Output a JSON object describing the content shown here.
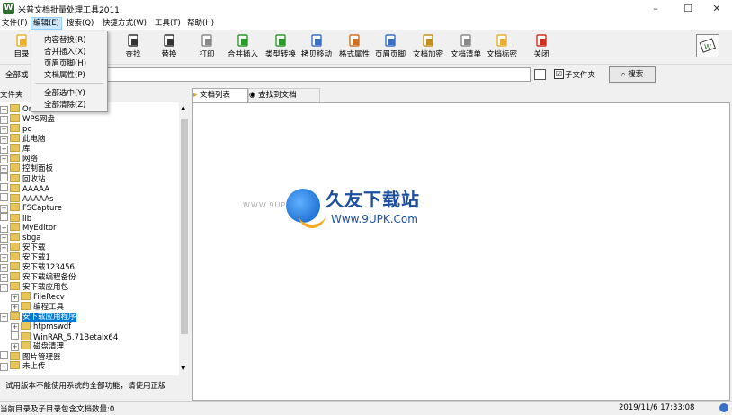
{
  "window": {
    "title": "米普文档批量处理工具2011",
    "minimize": "–",
    "maximize": "☐",
    "close": "✕"
  },
  "menubar": [
    {
      "label": "文件(F)"
    },
    {
      "label": "编辑(E)"
    },
    {
      "label": "搜索(Q)"
    },
    {
      "label": "快捷方式(W)"
    },
    {
      "label": "工具(T)"
    },
    {
      "label": "帮助(H)"
    }
  ],
  "edit_menu": {
    "items": [
      "内容替换(R)",
      "合并插入(X)",
      "页眉页脚(H)",
      "文档属性(P)",
      "全部选中(Y)",
      "全部清除(Z)"
    ]
  },
  "toolbar": [
    {
      "label": "目录",
      "icon": "folder-icon",
      "color": "#e8b030"
    },
    {
      "label": "查找",
      "icon": "binoculars-icon",
      "color": "#333333"
    },
    {
      "label": "替换",
      "icon": "replace-icon",
      "color": "#333333"
    },
    {
      "label": "打印",
      "icon": "printer-icon",
      "color": "#888888"
    },
    {
      "label": "合并插入",
      "icon": "merge-icon",
      "color": "#2a9a2a"
    },
    {
      "label": "类型转换",
      "icon": "convert-icon",
      "color": "#2a9a2a"
    },
    {
      "label": "拷贝移动",
      "icon": "copy-icon",
      "color": "#3a6fc4"
    },
    {
      "label": "格式属性",
      "icon": "format-icon",
      "color": "#d07020"
    },
    {
      "label": "页眉页脚",
      "icon": "header-icon",
      "color": "#3a6fc4"
    },
    {
      "label": "文档加密",
      "icon": "lock-icon",
      "color": "#c09020"
    },
    {
      "label": "文档清单",
      "icon": "list-icon",
      "color": "#888888"
    },
    {
      "label": "文档标密",
      "icon": "star-icon",
      "color": "#e8b030"
    },
    {
      "label": "关闭",
      "icon": "power-icon",
      "color": "#d03020"
    }
  ],
  "search": {
    "label": "全部或",
    "subdir_label": "子文件夹",
    "subdir_checked": "☑",
    "button": "搜索"
  },
  "folder_panel": {
    "header": "文件夹"
  },
  "tree": [
    {
      "label": "OneDrive",
      "indent": 0,
      "exp": true
    },
    {
      "label": "WPS网盘",
      "indent": 0,
      "exp": true
    },
    {
      "label": "pc",
      "indent": 0,
      "exp": true
    },
    {
      "label": "此电脑",
      "indent": 0,
      "exp": true
    },
    {
      "label": "库",
      "indent": 0,
      "exp": true
    },
    {
      "label": "网络",
      "indent": 0,
      "exp": true
    },
    {
      "label": "控制面板",
      "indent": 0,
      "exp": true
    },
    {
      "label": "回收站",
      "indent": 0,
      "exp": false
    },
    {
      "label": "AAAAA",
      "indent": 0,
      "exp": false
    },
    {
      "label": "AAAAAs",
      "indent": 0,
      "exp": false
    },
    {
      "label": "FSCapture",
      "indent": 0,
      "exp": true
    },
    {
      "label": "lib",
      "indent": 0,
      "exp": false
    },
    {
      "label": "MyEditor",
      "indent": 0,
      "exp": true
    },
    {
      "label": "sbga",
      "indent": 0,
      "exp": true
    },
    {
      "label": "安下载",
      "indent": 0,
      "exp": true
    },
    {
      "label": "安下载1",
      "indent": 0,
      "exp": true
    },
    {
      "label": "安下载123456",
      "indent": 0,
      "exp": true
    },
    {
      "label": "安下载编程备份",
      "indent": 0,
      "exp": true
    },
    {
      "label": "安下载应用包",
      "indent": 0,
      "exp": true
    },
    {
      "label": "FileRecv",
      "indent": 1,
      "exp": true
    },
    {
      "label": "编程工具",
      "indent": 1,
      "exp": true
    },
    {
      "label": "安下载应用程序",
      "indent": 0,
      "exp": true,
      "selected": true
    },
    {
      "label": "htpmswdf",
      "indent": 1,
      "exp": true
    },
    {
      "label": "WinRAR_5.71Betalx64",
      "indent": 1,
      "exp": false
    },
    {
      "label": "磁盘清理",
      "indent": 1,
      "exp": true
    },
    {
      "label": "图片管理器",
      "indent": 0,
      "exp": false
    },
    {
      "label": "未上传",
      "indent": 0,
      "exp": true
    }
  ],
  "trial_notice": "试用版本不能使用系统的全部功能，请使用正版",
  "tabs": [
    {
      "label": "文档列表"
    },
    {
      "label": "查找到文档"
    }
  ],
  "watermark": {
    "cn": "久友下载站",
    "url": "Www.9UPK.Com",
    "left": "WWW.9UPK.COM"
  },
  "status": {
    "left": "当前目录及子目录包含文档数量:0",
    "time": "2019/11/6 17:33:08"
  }
}
